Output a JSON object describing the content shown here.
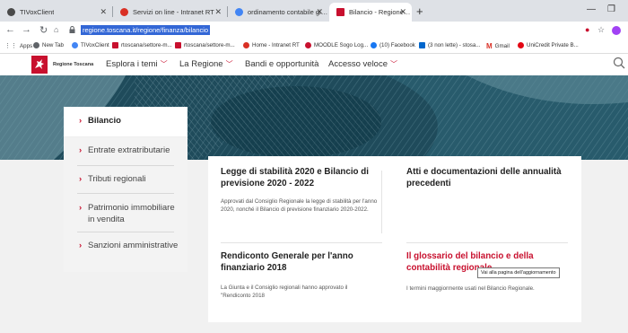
{
  "browser": {
    "tabs": [
      {
        "label": "TIVoxClient",
        "color": "#4a4a4a"
      },
      {
        "label": "Servizi on line - Intranet RT",
        "color": "#d93025"
      },
      {
        "label": "ordinamento contabile giunta re",
        "color": "#4285f4"
      },
      {
        "label": "Bilancio - Regione Toscana",
        "color": "#c8102e"
      }
    ],
    "url": "regione.toscana.it/regione/finanza/bilancio",
    "bookmarks": [
      {
        "label": "Apps",
        "color": "#5f6368"
      },
      {
        "label": "New Tab",
        "color": "#5f6368"
      },
      {
        "label": "TIVoxClient",
        "color": "#4285f4"
      },
      {
        "label": "rtoscana/settore-m...",
        "color": "#c8102e"
      },
      {
        "label": "rtoscana/settore-m...",
        "color": "#c8102e"
      },
      {
        "label": "Home - Intranet RT",
        "color": "#d93025"
      },
      {
        "label": "MOODLE Sogo Log...",
        "color": "#c8102e"
      },
      {
        "label": "(10) Facebook",
        "color": "#1877f2"
      },
      {
        "label": "(3 non lette) - stosa...",
        "color": "#0066cc"
      },
      {
        "label": "Gmail",
        "color": "#d93025"
      },
      {
        "label": "UniCredit Private B...",
        "color": "#e30613"
      }
    ]
  },
  "site": {
    "logo_text": "Regione Toscana",
    "nav": [
      "Esplora i temi",
      "La Regione",
      "Bandi e opportunità",
      "Accesso veloce"
    ]
  },
  "sidebar": {
    "items": [
      "Bilancio",
      "Entrate extratributarie",
      "Tributi regionali",
      "Patrimonio immobiliare in vendita",
      "Sanzioni amministrative"
    ]
  },
  "content": {
    "cards": [
      {
        "title": "Legge di stabilità 2020 e Bilancio di previsione 2020 - 2022",
        "text": "Approvati dal Consiglio Regionale la legge di stabilità per l'anno 2020, nonché il Bilancio di previsione finanziario 2020-2022."
      },
      {
        "title": "Atti e documentazioni delle annualità precedenti",
        "text": ""
      },
      {
        "title": "Rendiconto Generale per l'anno finanziario 2018",
        "text": "La Giunta e il Consiglio regionali hanno approvato il \"Rendiconto 2018"
      },
      {
        "title": "Il glossario del bilancio e della contabilità regionale",
        "text": "I termini maggiormente usati nel Bilancio Regionale."
      }
    ],
    "tooltip": "Vai alla pagina dell'aggiornamento"
  }
}
